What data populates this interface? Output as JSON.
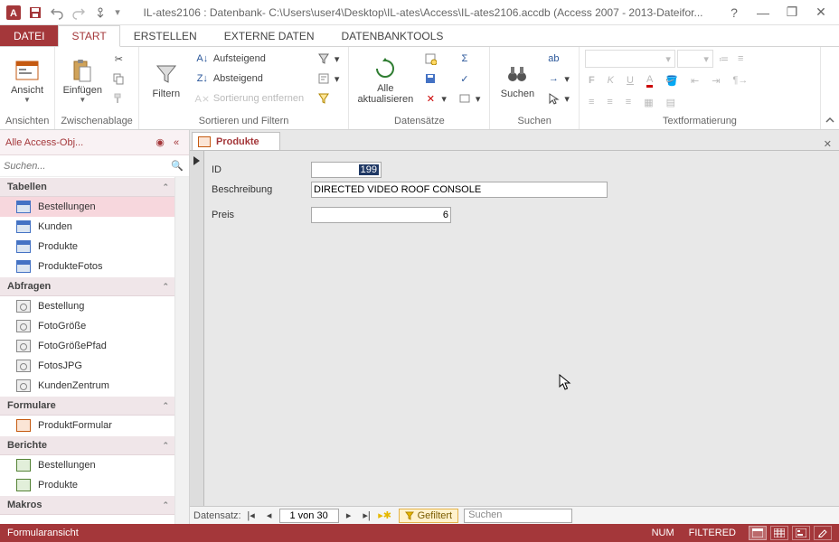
{
  "title": "IL-ates2106 : Datenbank- C:\\Users\\user4\\Desktop\\IL-ates\\Access\\IL-ates2106.accdb (Access 2007 - 2013-Dateifor...",
  "ribbon": {
    "tabs": {
      "datei": "DATEI",
      "start": "START",
      "erstellen": "ERSTELLEN",
      "externe": "EXTERNE DATEN",
      "tools": "DATENBANKTOOLS"
    },
    "groups": {
      "ansichten": "Ansichten",
      "zwischenablage": "Zwischenablage",
      "sortfilter": "Sortieren und Filtern",
      "datensaetze": "Datensätze",
      "suchen": "Suchen",
      "textfmt": "Textformatierung"
    },
    "buttons": {
      "ansicht": "Ansicht",
      "einfuegen": "Einfügen",
      "filtern": "Filtern",
      "aufsteigend": "Aufsteigend",
      "absteigend": "Absteigend",
      "sort_entfernen": "Sortierung entfernen",
      "alle_akt": "Alle\naktualisieren",
      "suchen": "Suchen"
    }
  },
  "nav": {
    "header": "Alle Access-Obj...",
    "search_placeholder": "Suchen...",
    "sections": {
      "tabellen": "Tabellen",
      "abfragen": "Abfragen",
      "formulare": "Formulare",
      "berichte": "Berichte",
      "makros": "Makros"
    },
    "tables": [
      "Bestellungen",
      "Kunden",
      "Produkte",
      "ProdukteFotos"
    ],
    "queries": [
      "Bestellung",
      "FotoGröße",
      "FotoGrößePfad",
      "FotosJPG",
      "KundenZentrum"
    ],
    "forms": [
      "ProduktFormular"
    ],
    "reports": [
      "Bestellungen",
      "Produkte"
    ]
  },
  "doc": {
    "tab": "Produkte",
    "fields": {
      "id_label": "ID",
      "id_value": "199",
      "besch_label": "Beschreibung",
      "besch_value": "DIRECTED VIDEO ROOF CONSOLE",
      "preis_label": "Preis",
      "preis_value": "6"
    }
  },
  "recnav": {
    "label": "Datensatz:",
    "position": "1 von 30",
    "filter": "Gefiltert",
    "search": "Suchen"
  },
  "status": {
    "left": "Formularansicht",
    "num": "NUM",
    "filtered": "FILTERED"
  }
}
